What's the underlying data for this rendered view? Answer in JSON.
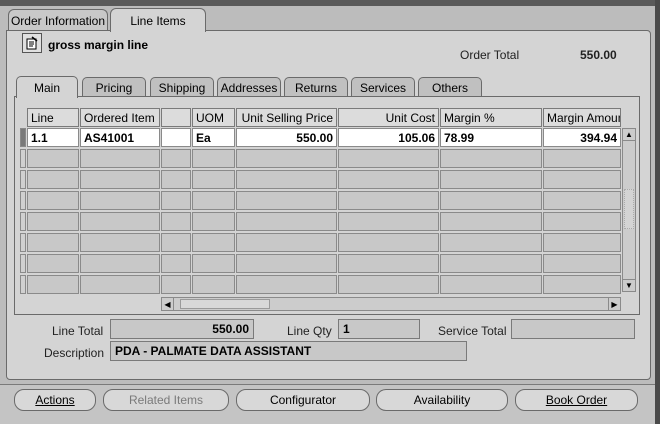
{
  "outer_tabs": [
    "Order Information",
    "Line Items"
  ],
  "header": {
    "title": "gross margin line",
    "order_total_label": "Order Total",
    "order_total_value": "550.00"
  },
  "inner_tabs": [
    "Main",
    "Pricing",
    "Shipping",
    "Addresses",
    "Returns",
    "Services",
    "Others"
  ],
  "grid": {
    "columns": [
      "Line",
      "Ordered Item",
      "",
      "UOM",
      "Unit Selling Price",
      "Unit Cost",
      "Margin %",
      "Margin Amount"
    ],
    "first_row": [
      "1.1",
      "AS41001",
      "",
      "Ea",
      "550.00",
      "105.06",
      "78.99",
      "394.94"
    ]
  },
  "footer_fields": {
    "line_total_label": "Line Total",
    "line_total_value": "550.00",
    "line_qty_label": "Line Qty",
    "line_qty_value": "1",
    "service_total_label": "Service Total",
    "service_total_value": "",
    "description_label": "Description",
    "description_value": "PDA - PALMATE DATA ASSISTANT"
  },
  "buttons": {
    "actions": "Actions",
    "related_items": "Related Items",
    "configurator": "Configurator",
    "availability": "Availability",
    "book_order": "Book Order"
  }
}
